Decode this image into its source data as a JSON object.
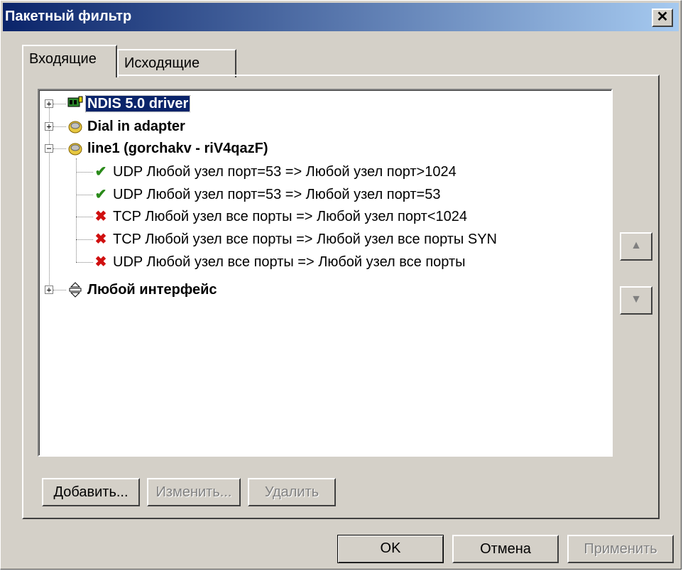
{
  "window": {
    "title": "Пакетный фильтр",
    "close_label": "✕"
  },
  "tabs": [
    {
      "label": "Входящие"
    },
    {
      "label": "Исходящие"
    }
  ],
  "tree": {
    "nodes": [
      {
        "label": "NDIS 5.0 driver",
        "expander": "+",
        "icon": "network-card-icon"
      },
      {
        "label": "Dial in adapter",
        "expander": "+",
        "icon": "modem-icon"
      },
      {
        "label": "line1 (gorchakv - riV4qazF)",
        "expander": "−",
        "icon": "modem-icon"
      },
      {
        "label": "UDP Любой узел порт=53 => Любой узел порт>1024",
        "icon": "allow-check-icon"
      },
      {
        "label": "UDP Любой узел порт=53 => Любой узел порт=53",
        "icon": "allow-check-icon"
      },
      {
        "label": "TCP Любой узел все порты => Любой узел порт<1024",
        "icon": "deny-cross-icon"
      },
      {
        "label": "TCP Любой узел все порты => Любой узел все порты SYN",
        "icon": "deny-cross-icon"
      },
      {
        "label": "UDP Любой узел все порты => Любой узел все порты",
        "icon": "deny-cross-icon"
      },
      {
        "label": "Любой интерфейс",
        "expander": "+",
        "icon": "any-interface-icon"
      }
    ]
  },
  "side_buttons": {
    "up": "▲",
    "down": "▼"
  },
  "actions": {
    "add": "Добавить...",
    "edit": "Изменить...",
    "delete": "Удалить"
  },
  "footer": {
    "ok": "OK",
    "cancel": "Отмена",
    "apply": "Применить"
  },
  "colors": {
    "title_start": "#0a246a",
    "title_end": "#a6caf0",
    "face": "#d4d0c8",
    "check": "#2a8a1a",
    "cross": "#d01010"
  }
}
